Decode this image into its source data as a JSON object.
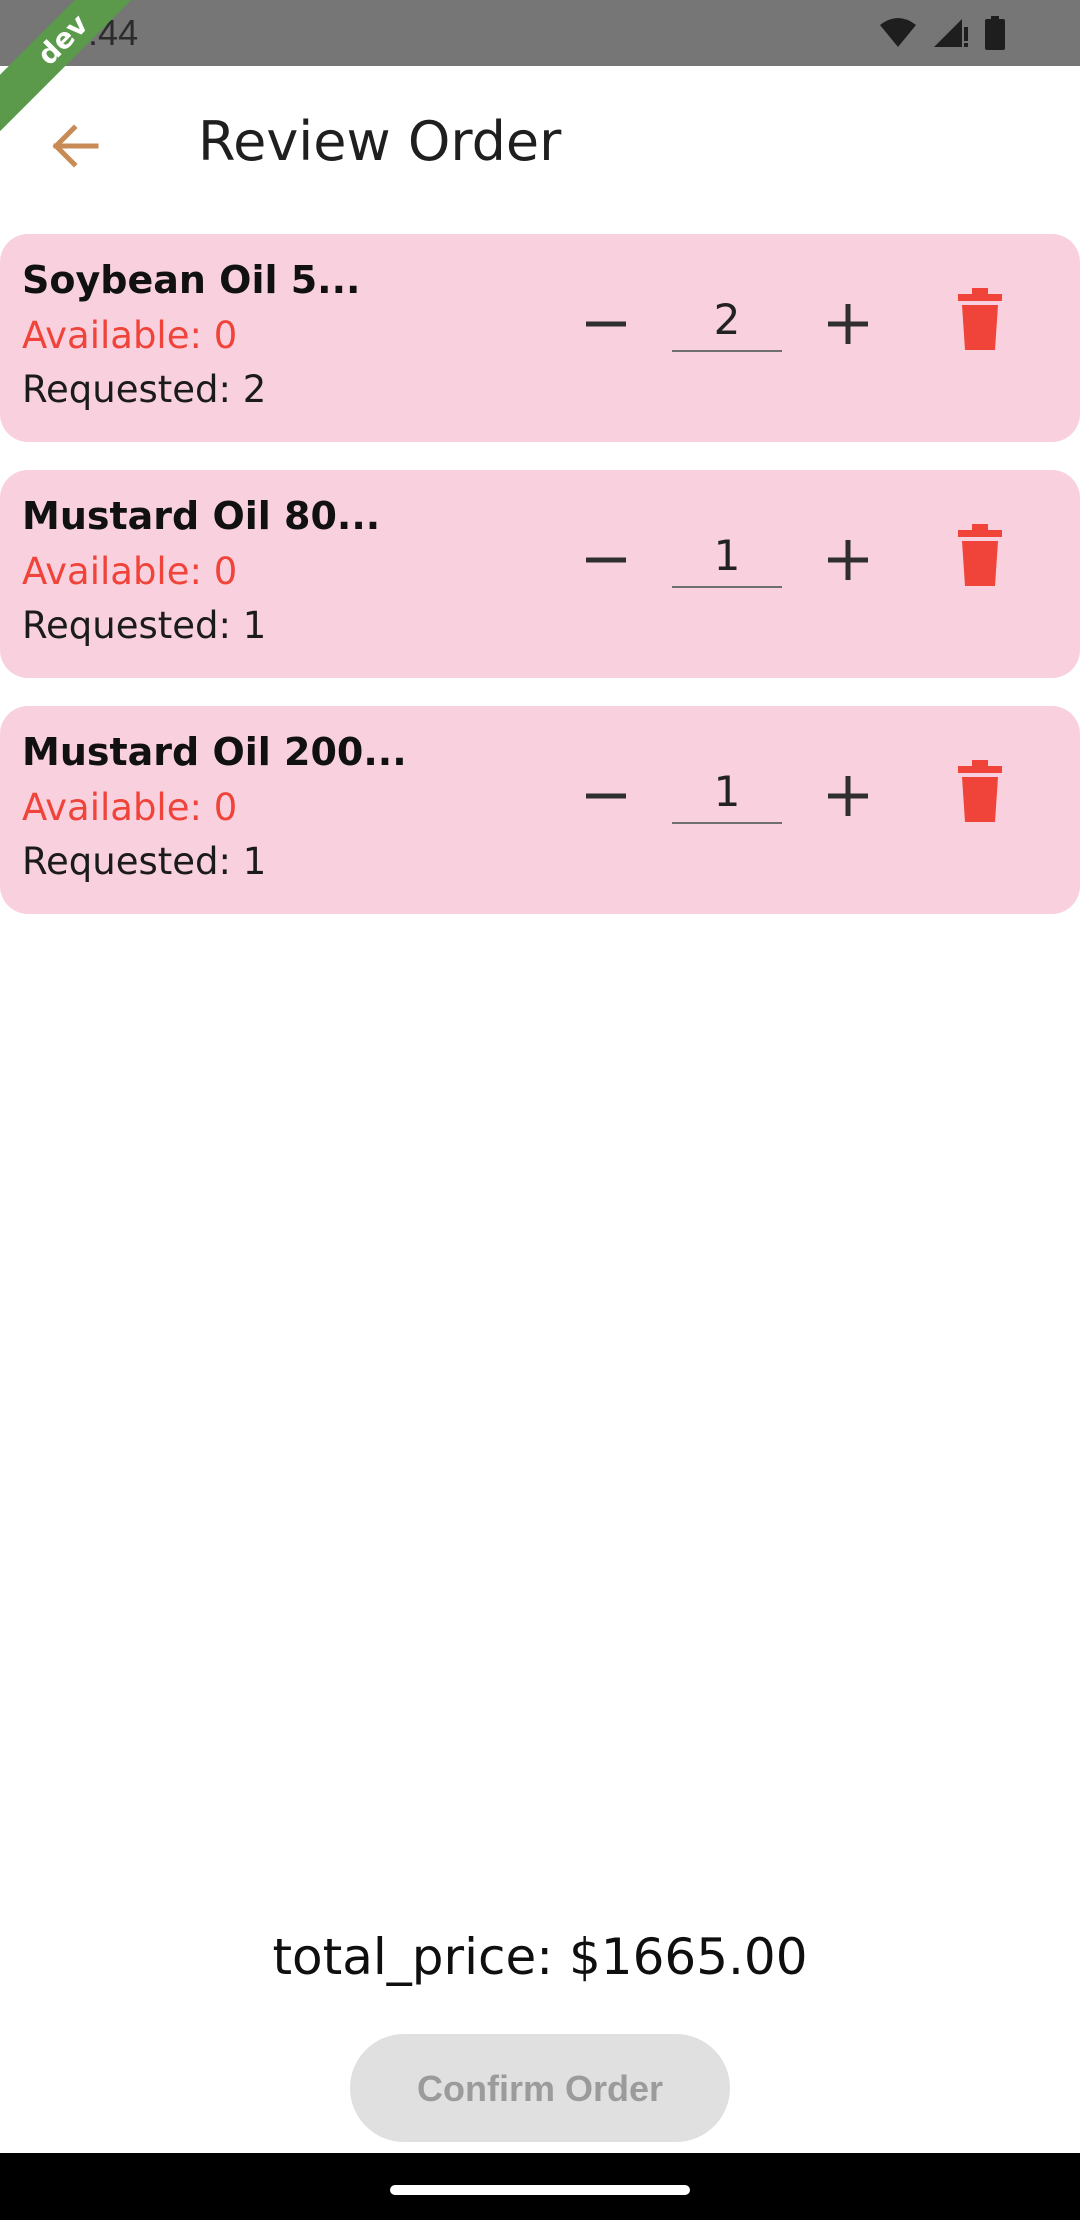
{
  "status_bar": {
    "time": "12:44"
  },
  "dev_ribbon": "dev",
  "header": {
    "title": "Review Order"
  },
  "items": [
    {
      "name": "Soybean Oil 5...",
      "available": "Available: 0",
      "requested": "Requested: 2",
      "quantity": "2"
    },
    {
      "name": "Mustard Oil 80...",
      "available": "Available: 0",
      "requested": "Requested: 1",
      "quantity": "1"
    },
    {
      "name": "Mustard Oil 200...",
      "available": "Available: 0",
      "requested": "Requested: 1",
      "quantity": "1"
    }
  ],
  "footer": {
    "total_price": "total_price: $1665.00",
    "confirm_label": "Confirm Order"
  },
  "colors": {
    "card_bg": "#f9d1de",
    "danger": "#f0443a",
    "back_arrow": "#c98b55",
    "ribbon": "#5a9a4a"
  }
}
